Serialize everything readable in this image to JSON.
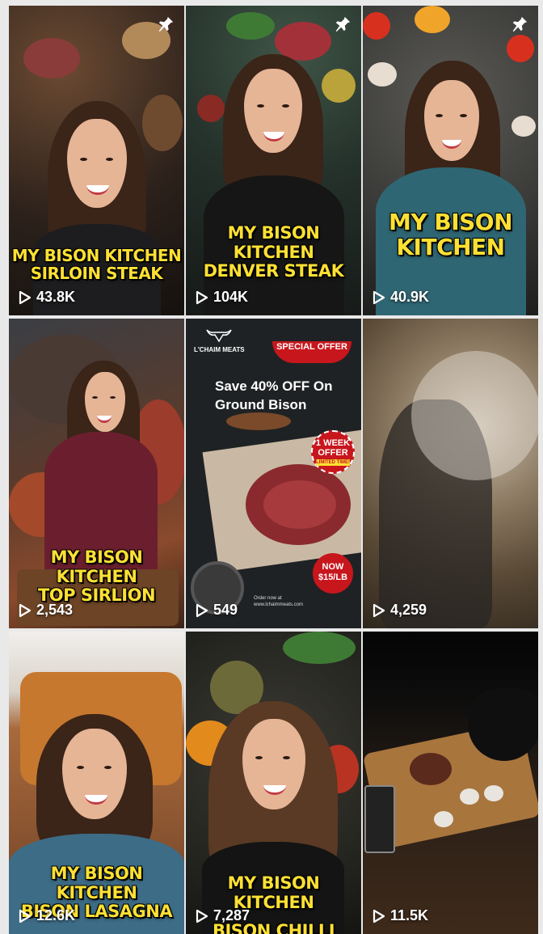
{
  "icons": {
    "play": "play-icon",
    "pin": "pin-icon"
  },
  "colors": {
    "caption_yellow": "#fde033",
    "ad_red": "#c8161d"
  },
  "videos": [
    {
      "caption_line1": "MY BISON KITCHEN",
      "caption_line2": "SIRLOIN STEAK",
      "views": "43.8K",
      "pinned": true
    },
    {
      "caption_line1": "MY BISON KITCHEN",
      "caption_line2": "DENVER STEAK",
      "views": "104K",
      "pinned": true
    },
    {
      "caption_line1": "MY BISON",
      "caption_line2": "KITCHEN",
      "views": "40.9K",
      "pinned": true
    },
    {
      "caption_line1": "MY BISON KITCHEN",
      "caption_line2": "TOP SIRLION",
      "views": "2,543",
      "pinned": false
    },
    {
      "views": "549",
      "pinned": false,
      "ad": {
        "brand": "L'CHAIM MEATS",
        "ribbon": "SPECIAL OFFER",
        "headline": "Save 40% OFF On Ground Bison",
        "badge_line1": "1 WEEK",
        "badge_line2": "OFFER",
        "badge_small": "LIMITED TIME!",
        "price_line1": "NOW",
        "price_line2": "$15/LB",
        "order_line1": "Order now at",
        "order_line2": "www.lchaimmeats.com"
      }
    },
    {
      "views": "4,259",
      "pinned": false
    },
    {
      "caption_line1": "MY BISON KITCHEN",
      "caption_line2": "BISON LASAGNA",
      "views": "12.6K",
      "pinned": false
    },
    {
      "caption_line1": "MY BISON KITCHEN",
      "caption_line2": "BISON CHILLI",
      "views": "7,287",
      "pinned": false
    },
    {
      "views": "11.5K",
      "pinned": false
    }
  ]
}
